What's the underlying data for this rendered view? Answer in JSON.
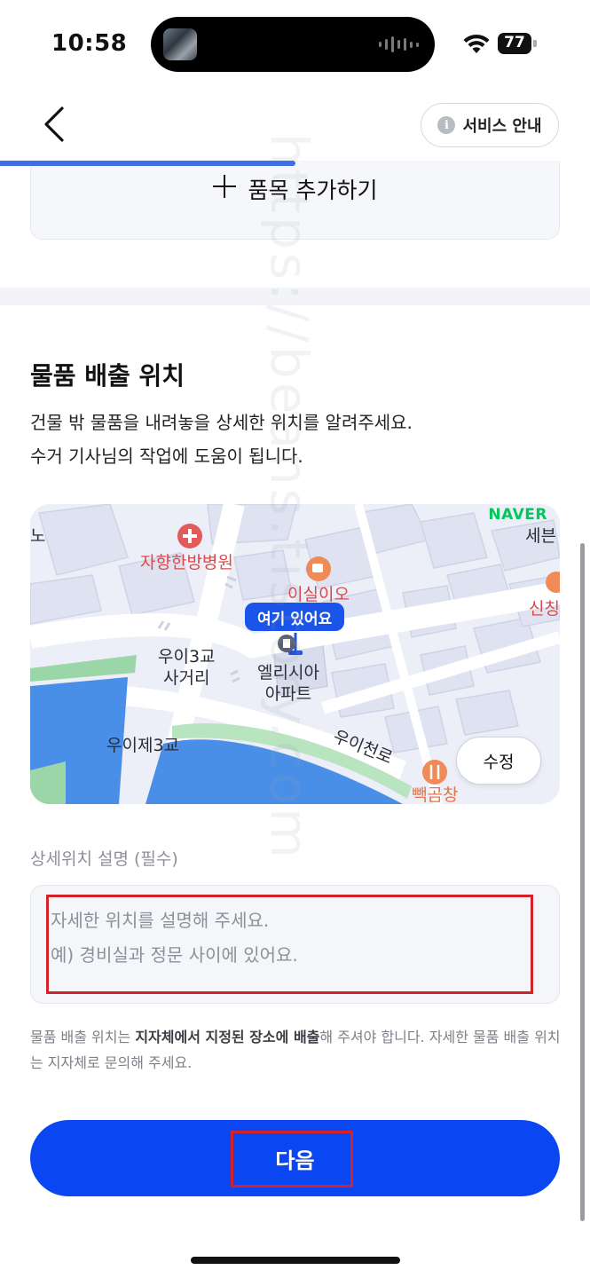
{
  "status_bar": {
    "time": "10:58",
    "battery": "77"
  },
  "header": {
    "service_button_label": "서비스 안내",
    "info_icon_glyph": "i",
    "progress_percent": 50
  },
  "add_item": {
    "label": "품목 추가하기"
  },
  "section": {
    "title": "물품 배출 위치",
    "description_line1": "건물 밖 물품을 내려놓을 상세한 위치를 알려주세요.",
    "description_line2": "수거 기사님의 작업에 도움이 됩니다."
  },
  "map": {
    "provider": "NAVER",
    "pin_label": "여기 있어요",
    "edit_button": "수정",
    "labels": {
      "hospital": "자향한방병원",
      "cafe": "이실이오",
      "intersection_line1": "우이3교",
      "intersection_line2": "사거리",
      "apartment_line1": "엘리시아",
      "apartment_line2": "아파트",
      "bridge": "우이제3교",
      "road": "우이천로",
      "restaurant": "빽곰창",
      "edge_right_top": "세븐",
      "edge_right_mid": "신칭",
      "edge_left": "노"
    }
  },
  "detail_field": {
    "label": "상세위치 설명 (필수)",
    "placeholder": "자세한 위치를 설명해 주세요.\n예) 경비실과 정문 사이에 있어요."
  },
  "notice": {
    "part1": "물품 배출 위치는 ",
    "bold": "지자체에서 지정된 장소에 배출",
    "part2": "해 주셔야 합니다. 자세한 물품 배출 위치는 지자체로 문의해 주세요."
  },
  "next_button": {
    "label": "다음"
  },
  "watermark": {
    "text": "https://beans.tistory.com"
  },
  "colors": {
    "primary": "#0a46f2",
    "highlight": "#d2232a",
    "naver_green": "#03c75a"
  }
}
